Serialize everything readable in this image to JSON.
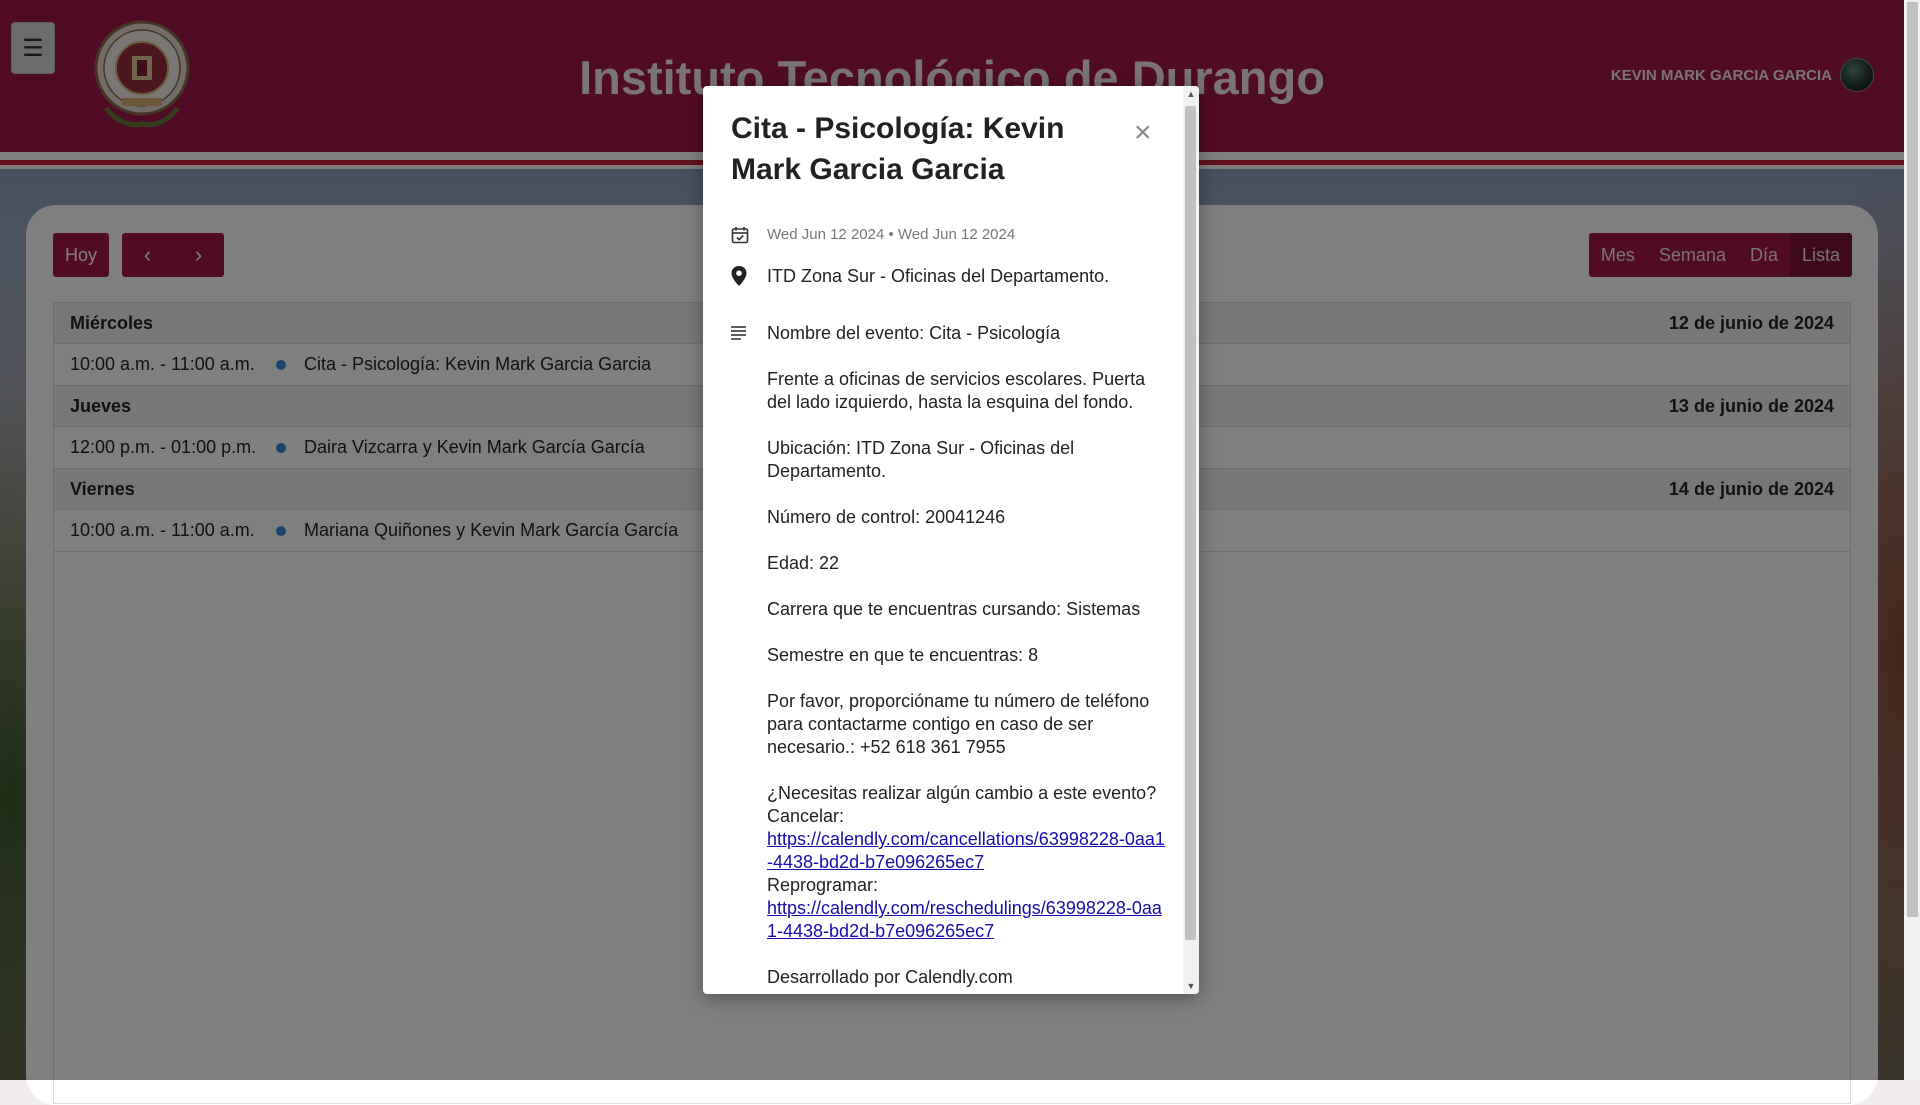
{
  "header": {
    "title": "Instituto Tecnológico de Durango",
    "user_name": "KEVIN MARK GARCIA GARCIA",
    "brand_color": "#a3194a"
  },
  "toolbar": {
    "today_label": "Hoy",
    "prev_icon": "chevron-left-icon",
    "next_icon": "chevron-right-icon",
    "views": [
      "Mes",
      "Semana",
      "Día",
      "Lista"
    ],
    "active_view": "Lista"
  },
  "list": {
    "days": [
      {
        "weekday": "Miércoles",
        "date": "12 de junio de 2024",
        "events": [
          {
            "time": "10:00 a.m. - 11:00 a.m.",
            "title": "Cita - Psicología: Kevin Mark Garcia Garcia"
          }
        ]
      },
      {
        "weekday": "Jueves",
        "date": "13 de junio de 2024",
        "events": [
          {
            "time": "12:00 p.m. - 01:00 p.m.",
            "title": "Daira Vizcarra y Kevin Mark García García"
          }
        ]
      },
      {
        "weekday": "Viernes",
        "date": "14 de junio de 2024",
        "events": [
          {
            "time": "10:00 a.m. - 11:00 a.m.",
            "title": "Mariana Quiñones y Kevin Mark García García"
          }
        ]
      }
    ],
    "event_dot_color": "#3788d8"
  },
  "modal": {
    "title": "Cita - Psicología: Kevin Mark Garcia Garcia",
    "close_label": "×",
    "date_range": "Wed Jun 12 2024 • Wed Jun 12 2024",
    "location": "ITD Zona Sur - Oficinas del Departamento.",
    "description": {
      "event_name": "Nombre del evento: Cita - Psicología",
      "directions": "Frente a oficinas de servicios escolares. Puerta del lado izquierdo, hasta la esquina del fondo.",
      "location_line": "Ubicación: ITD Zona Sur - Oficinas del Departamento.",
      "control_number": "Número de control: 20041246",
      "age": "Edad: 22",
      "career": "Carrera que te encuentras cursando: Sistemas",
      "semester": "Semestre en que te encuentras: 8",
      "phone": "Por favor, proporcióname tu número de teléfono para contactarme contigo en caso de ser necesario.: +52 618 361 7955",
      "change_question": "¿Necesitas realizar algún cambio a este evento?",
      "cancel_label": "Cancelar:",
      "cancel_url": "https://calendly.com/cancellations/63998228-0aa1-4438-bd2d-b7e096265ec7",
      "reschedule_label": "Reprogramar:",
      "reschedule_url": "https://calendly.com/reschedulings/63998228-0aa1-4438-bd2d-b7e096265ec7",
      "footer": "Desarrollado por Calendly.com"
    }
  }
}
